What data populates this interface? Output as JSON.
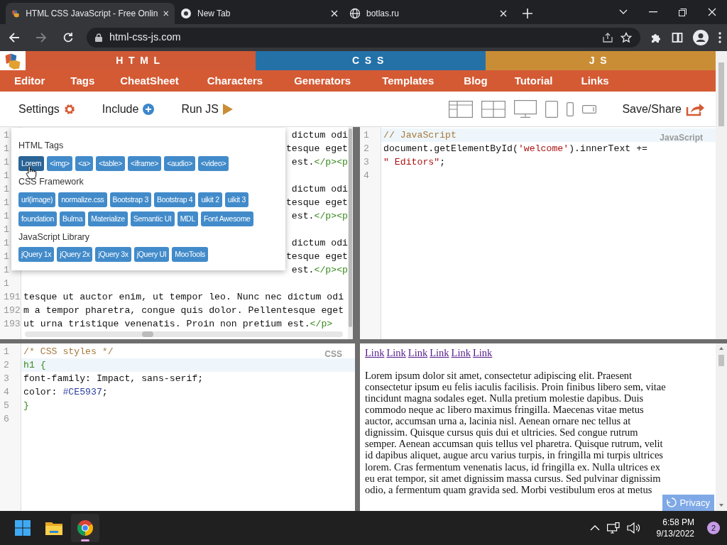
{
  "browser": {
    "tabs": [
      {
        "title": "HTML CSS JavaScript - Free Onlin",
        "selected": true
      },
      {
        "title": "New Tab",
        "selected": false
      },
      {
        "title": "botlas.ru",
        "selected": false
      }
    ],
    "nav_buttons": [
      {
        "kind": "back",
        "disabled": false
      },
      {
        "kind": "forward",
        "disabled": true
      },
      {
        "kind": "reload",
        "disabled": false
      }
    ],
    "url": "html-css-js.com"
  },
  "site": {
    "sections": [
      {
        "label": "HTML",
        "color": "#d05a36"
      },
      {
        "label": "CSS",
        "color": "#2471a8"
      },
      {
        "label": "JS",
        "color": "#c98e35"
      }
    ],
    "menu": [
      "Editor",
      "Tags",
      "CheatSheet",
      "Characters",
      "Generators",
      "Templates",
      "Blog",
      "Tutorial",
      "Links"
    ],
    "toolbar": {
      "actions": [
        {
          "label": "Settings",
          "kind": "gear"
        },
        {
          "label": "Include",
          "kind": "plus"
        },
        {
          "label": "Run JS",
          "kind": "play"
        }
      ],
      "view_buttons": [
        {
          "kind": "layout-a"
        },
        {
          "kind": "layout-b"
        },
        {
          "kind": "desktop"
        },
        {
          "kind": "tablet"
        },
        {
          "kind": "phone"
        },
        {
          "kind": "phone-landscape"
        }
      ],
      "save": "Save/Share"
    }
  },
  "html_editor": {
    "lines": [
      {
        "kind": "partial",
        "num": "1",
        "tokens": [
          {
            "kind": "plain",
            "text": "dictum odi"
          }
        ]
      },
      {
        "kind": "partial",
        "num": "1",
        "tokens": [
          {
            "kind": "plain",
            "text": "tesque eget"
          }
        ]
      },
      {
        "kind": "partial",
        "num": "1",
        "tokens": [
          {
            "kind": "plain",
            "text": "est."
          },
          {
            "kind": "tag",
            "text": "</p><p"
          }
        ]
      },
      {
        "kind": "partial",
        "num": "1"
      },
      {
        "kind": "partial",
        "num": "1",
        "tokens": [
          {
            "kind": "plain",
            "text": "dictum odi"
          }
        ]
      },
      {
        "kind": "partial",
        "num": "1",
        "tokens": [
          {
            "kind": "plain",
            "text": "tesque eget"
          }
        ]
      },
      {
        "kind": "partial",
        "num": "1",
        "tokens": [
          {
            "kind": "plain",
            "text": "est."
          },
          {
            "kind": "tag",
            "text": "</p><p"
          }
        ]
      },
      {
        "kind": "partial",
        "num": "1"
      },
      {
        "kind": "partial",
        "num": "1",
        "tokens": [
          {
            "kind": "plain",
            "text": "dictum odi"
          }
        ]
      },
      {
        "kind": "partial",
        "num": "1",
        "tokens": [
          {
            "kind": "plain",
            "text": "tesque eget"
          }
        ]
      },
      {
        "kind": "partial",
        "num": "1",
        "tokens": [
          {
            "kind": "plain",
            "text": "est."
          },
          {
            "kind": "tag",
            "text": "</p><p"
          }
        ]
      },
      {
        "kind": "partial",
        "num": "1"
      },
      {
        "kind": "full",
        "num": "191",
        "tokens": [
          {
            "kind": "plain",
            "text": "tesque ut auctor enim, ut tempor leo. Nunc nec dictum odi"
          }
        ]
      },
      {
        "kind": "full",
        "num": "192",
        "tokens": [
          {
            "kind": "plain",
            "text": "m a tempor pharetra, congue quis dolor. Pellentesque eget"
          }
        ]
      },
      {
        "kind": "full",
        "num": "193",
        "tokens": [
          {
            "kind": "plain",
            "text": "ut urna tristique venenatis. Proin non pretium est."
          },
          {
            "kind": "tag",
            "text": "</p>"
          }
        ]
      }
    ]
  },
  "insert_menu": {
    "groups": [
      {
        "title": "HTML Tags",
        "buttons": [
          {
            "label": "Lorem",
            "hovered": true
          },
          {
            "label": "<img>",
            "hovered": false
          },
          {
            "label": "<a>",
            "hovered": false
          },
          {
            "label": "<table>",
            "hovered": false
          },
          {
            "label": "<iframe>",
            "hovered": false
          },
          {
            "label": "<audio>",
            "hovered": false
          },
          {
            "label": "<video>",
            "hovered": false
          }
        ]
      },
      {
        "title": "CSS Framework",
        "buttons": [
          {
            "label": "url(image)",
            "hovered": false
          },
          {
            "label": "normalize.css",
            "hovered": false
          },
          {
            "label": "Bootstrap 3",
            "hovered": false
          },
          {
            "label": "Bootstrap 4",
            "hovered": false
          },
          {
            "label": "uikit 2",
            "hovered": false
          },
          {
            "label": "uikit 3",
            "hovered": false
          },
          {
            "label": "foundation",
            "hovered": false
          },
          {
            "label": "Bulma",
            "hovered": false
          },
          {
            "label": "Materialize",
            "hovered": false
          },
          {
            "label": "Semantic UI",
            "hovered": false
          },
          {
            "label": "MDL",
            "hovered": false
          },
          {
            "label": "Font Awesome",
            "hovered": false
          }
        ]
      },
      {
        "title": "JavaScript Library",
        "buttons": [
          {
            "label": "jQuery 1x",
            "hovered": false
          },
          {
            "label": "jQuery 2x",
            "hovered": false
          },
          {
            "label": "jQuery 3x",
            "hovered": false
          },
          {
            "label": "jQuery UI",
            "hovered": false
          },
          {
            "label": "MooTools",
            "hovered": false
          }
        ]
      }
    ]
  },
  "js_editor": {
    "mode_label": "JavaScript",
    "lines": [
      {
        "num": "1",
        "active": true,
        "tokens": [
          {
            "kind": "comment",
            "text": "// JavaScript"
          }
        ]
      },
      {
        "num": "2",
        "active": false,
        "tokens": [
          {
            "kind": "plain",
            "text": "document.getElementById("
          },
          {
            "kind": "string",
            "text": "'welcome'"
          },
          {
            "kind": "plain",
            "text": ").innerText +="
          }
        ]
      },
      {
        "num": "3",
        "active": false,
        "tokens": [
          {
            "kind": "string",
            "text": "\" Editors\""
          },
          {
            "kind": "plain",
            "text": ";"
          }
        ]
      },
      {
        "num": "4",
        "active": false
      }
    ]
  },
  "css_editor": {
    "mode_label": "CSS",
    "lines": [
      {
        "num": "1",
        "active": false,
        "tokens": [
          {
            "kind": "comment",
            "text": "/* CSS styles */"
          }
        ]
      },
      {
        "num": "2",
        "active": true,
        "tokens": [
          {
            "kind": "tag",
            "text": "h1 {"
          }
        ]
      },
      {
        "num": "3",
        "active": false,
        "tokens": [
          {
            "kind": "plain",
            "text": "font-family: Impact, sans-serif;"
          }
        ]
      },
      {
        "num": "4",
        "active": false,
        "tokens": [
          {
            "kind": "plain",
            "text": "color: "
          },
          {
            "kind": "atom",
            "text": "#CE5937"
          },
          {
            "kind": "plain",
            "text": ";"
          }
        ]
      },
      {
        "num": "5",
        "active": false,
        "tokens": [
          {
            "kind": "tag",
            "text": "}"
          }
        ]
      },
      {
        "num": "6",
        "active": false
      }
    ]
  },
  "preview": {
    "links": [
      "Link",
      "Link",
      "Link",
      "Link",
      "Link",
      "Link"
    ],
    "paragraph": "Lorem ipsum dolor sit amet, consectetur adipiscing elit. Praesent consectetur ipsum eu felis iaculis facilisis. Proin finibus libero sem, vitae tincidunt magna sodales eget. Nulla pretium molestie dapibus. Duis commodo neque ac libero maximus fringilla. Maecenas vitae metus auctor, accumsan urna a, lacinia nisl. Aenean ornare nec tellus at dignissim. Quisque cursus quis dui et ultricies. Sed congue rutrum semper. Aenean accumsan quis tellus vel pharetra. Quisque rutrum, velit id dapibus aliquet, augue arcu varius turpis, in fringilla mi turpis ultrices lorem. Cras fermentum venenatis lacus, id fringilla ex. Nulla ultrices ex eu erat tempor, sit amet dignissim massa cursus. Sed pulvinar dignissim odio, a fermentum quam gravida sed. Morbi vestibulum eros at metus",
    "privacy_badge": "Privacy"
  },
  "taskbar": {
    "apps": [
      {
        "kind": "start",
        "active": false
      },
      {
        "kind": "explorer",
        "active": false
      },
      {
        "kind": "chrome",
        "active": true
      }
    ],
    "time": "6:58 PM",
    "date": "9/13/2022",
    "notifications": "2"
  }
}
